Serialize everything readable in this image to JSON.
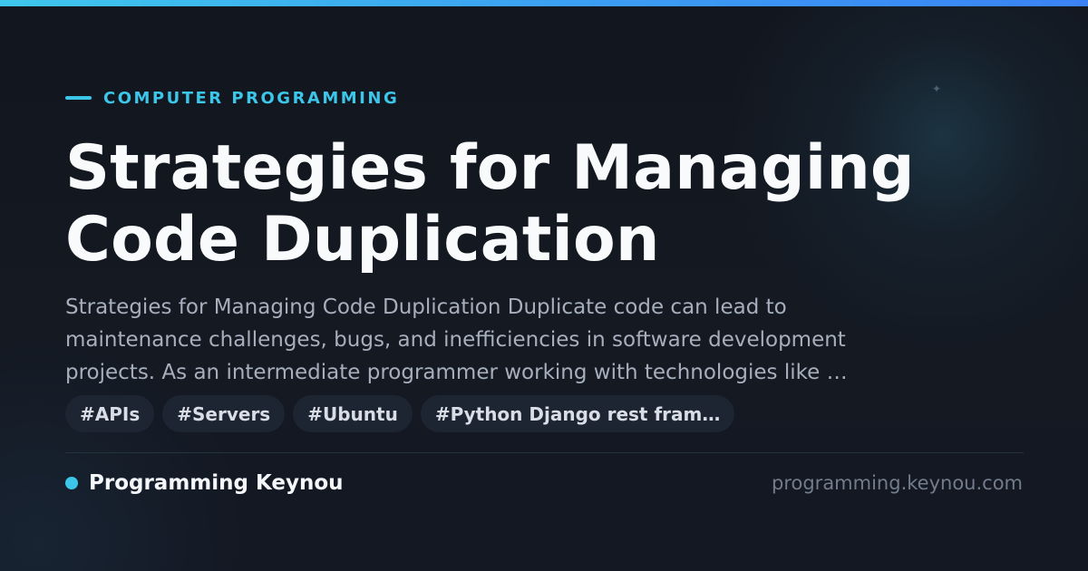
{
  "colors": {
    "accent": "#3cc6ea",
    "background": "#131822",
    "title": "#f8fafc",
    "excerpt": "#a7afbd",
    "tag_background": "#1e2532",
    "url": "#737c8b"
  },
  "category": {
    "label": "COMPUTER PROGRAMMING"
  },
  "article": {
    "title_line_1": "Strategies for Managing",
    "title_line_2": "Code Duplication",
    "excerpt_line_1": "Strategies for Managing Code Duplication Duplicate code can lead to",
    "excerpt_line_2": "maintenance challenges, bugs, and inefficiencies in software development",
    "excerpt_line_3": "projects. As an intermediate programmer working with technologies like …"
  },
  "tags": [
    {
      "label": "#APIs"
    },
    {
      "label": "#Servers"
    },
    {
      "label": "#Ubuntu"
    },
    {
      "label": "#Python Django rest fram…"
    }
  ],
  "footer": {
    "site_name": "Programming Keynou",
    "site_url": "programming.keynou.com"
  },
  "icons": {
    "category_marker": "dash-icon",
    "site_marker": "dot-icon",
    "background_sparkle": "sparkle-icon"
  }
}
